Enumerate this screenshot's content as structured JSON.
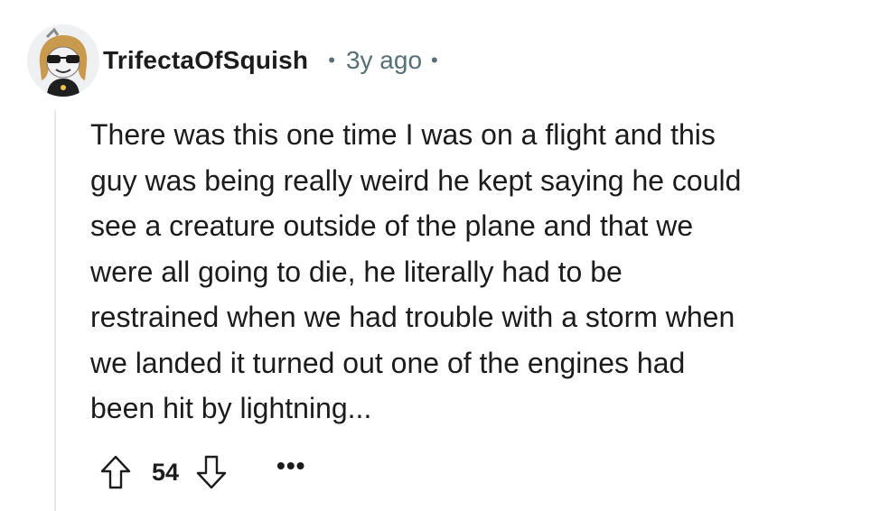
{
  "comment": {
    "author": "TrifectaOfSquish",
    "separator": "•",
    "time_ago": "3y ago",
    "body_lines": [
      "There was this one time I was on a flight and this",
      "guy was being really weird he kept saying he could",
      "see a creature outside of the plane and that we",
      "were all going to die, he literally had to be",
      "restrained when we had trouble with a storm when",
      "we landed it turned out one of the engines had",
      "been hit by lightning..."
    ],
    "score": "54",
    "more_label": "•••"
  },
  "icons": {
    "upvote": "arrow-up-outline-icon",
    "downvote": "arrow-down-outline-icon",
    "more": "ellipsis-icon"
  },
  "colors": {
    "text": "#1c1c1c",
    "meta": "#576f76",
    "thread_line": "#e5e7e9",
    "background": "#ffffff"
  }
}
